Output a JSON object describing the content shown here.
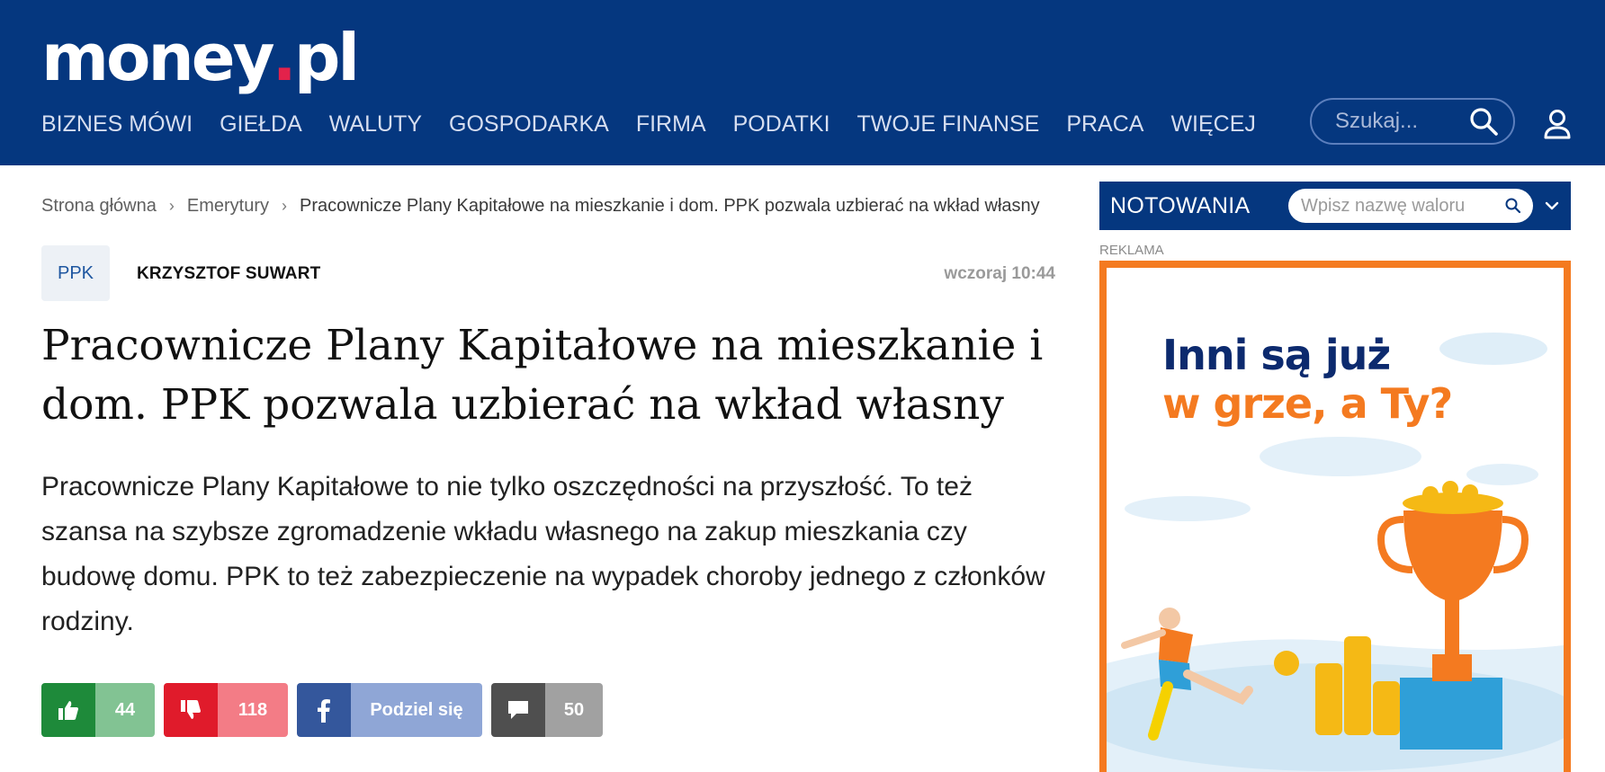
{
  "header": {
    "logo_main": "money",
    "logo_dot": ".",
    "logo_tld": "pl",
    "nav": [
      "BIZNES MÓWI",
      "GIEŁDA",
      "WALUTY",
      "GOSPODARKA",
      "FIRMA",
      "PODATKI",
      "TWOJE FINANSE",
      "PRACA",
      "WIĘCEJ"
    ],
    "search_placeholder": "Szukaj...",
    "search_icon": "search-icon",
    "user_icon": "user-icon"
  },
  "breadcrumb": {
    "home": "Strona główna",
    "section": "Emerytury",
    "current": "Pracownicze Plany Kapitałowe na mieszkanie i dom. PPK pozwala uzbierać na wkład własny"
  },
  "article": {
    "tag": "PPK",
    "author": "KRZYSZTOF SUWART",
    "date": "wczoraj 10:44",
    "title": "Pracownicze Plany Kapitałowe na mieszkanie i dom. PPK pozwala uzbierać na wkład własny",
    "lead": "Pracownicze Plany Kapitałowe to nie tylko oszczędności na przyszłość. To też szansa na szybsze zgromadzenie wkładu własnego na zakup mieszkania czy budowę domu. PPK to też zabezpieczenie na wypadek choroby jednego z członków rodziny."
  },
  "actions": {
    "likes": "44",
    "dislikes": "118",
    "share_label": "Podziel się",
    "comments": "50"
  },
  "sidebar": {
    "quotes_title": "NOTOWANIA",
    "quotes_placeholder": "Wpisz nazwę waloru",
    "ad_label": "REKLAMA",
    "ad_line1": "Inni są już",
    "ad_line2": "w grze, a Ty?"
  },
  "colors": {
    "header_bg": "#05377f",
    "logo_dot": "#e3224b",
    "like": "#1e8a3a",
    "dislike": "#e01b2b",
    "share": "#34579c",
    "comment": "#4f4f4f",
    "ad_border": "#f47a20"
  }
}
